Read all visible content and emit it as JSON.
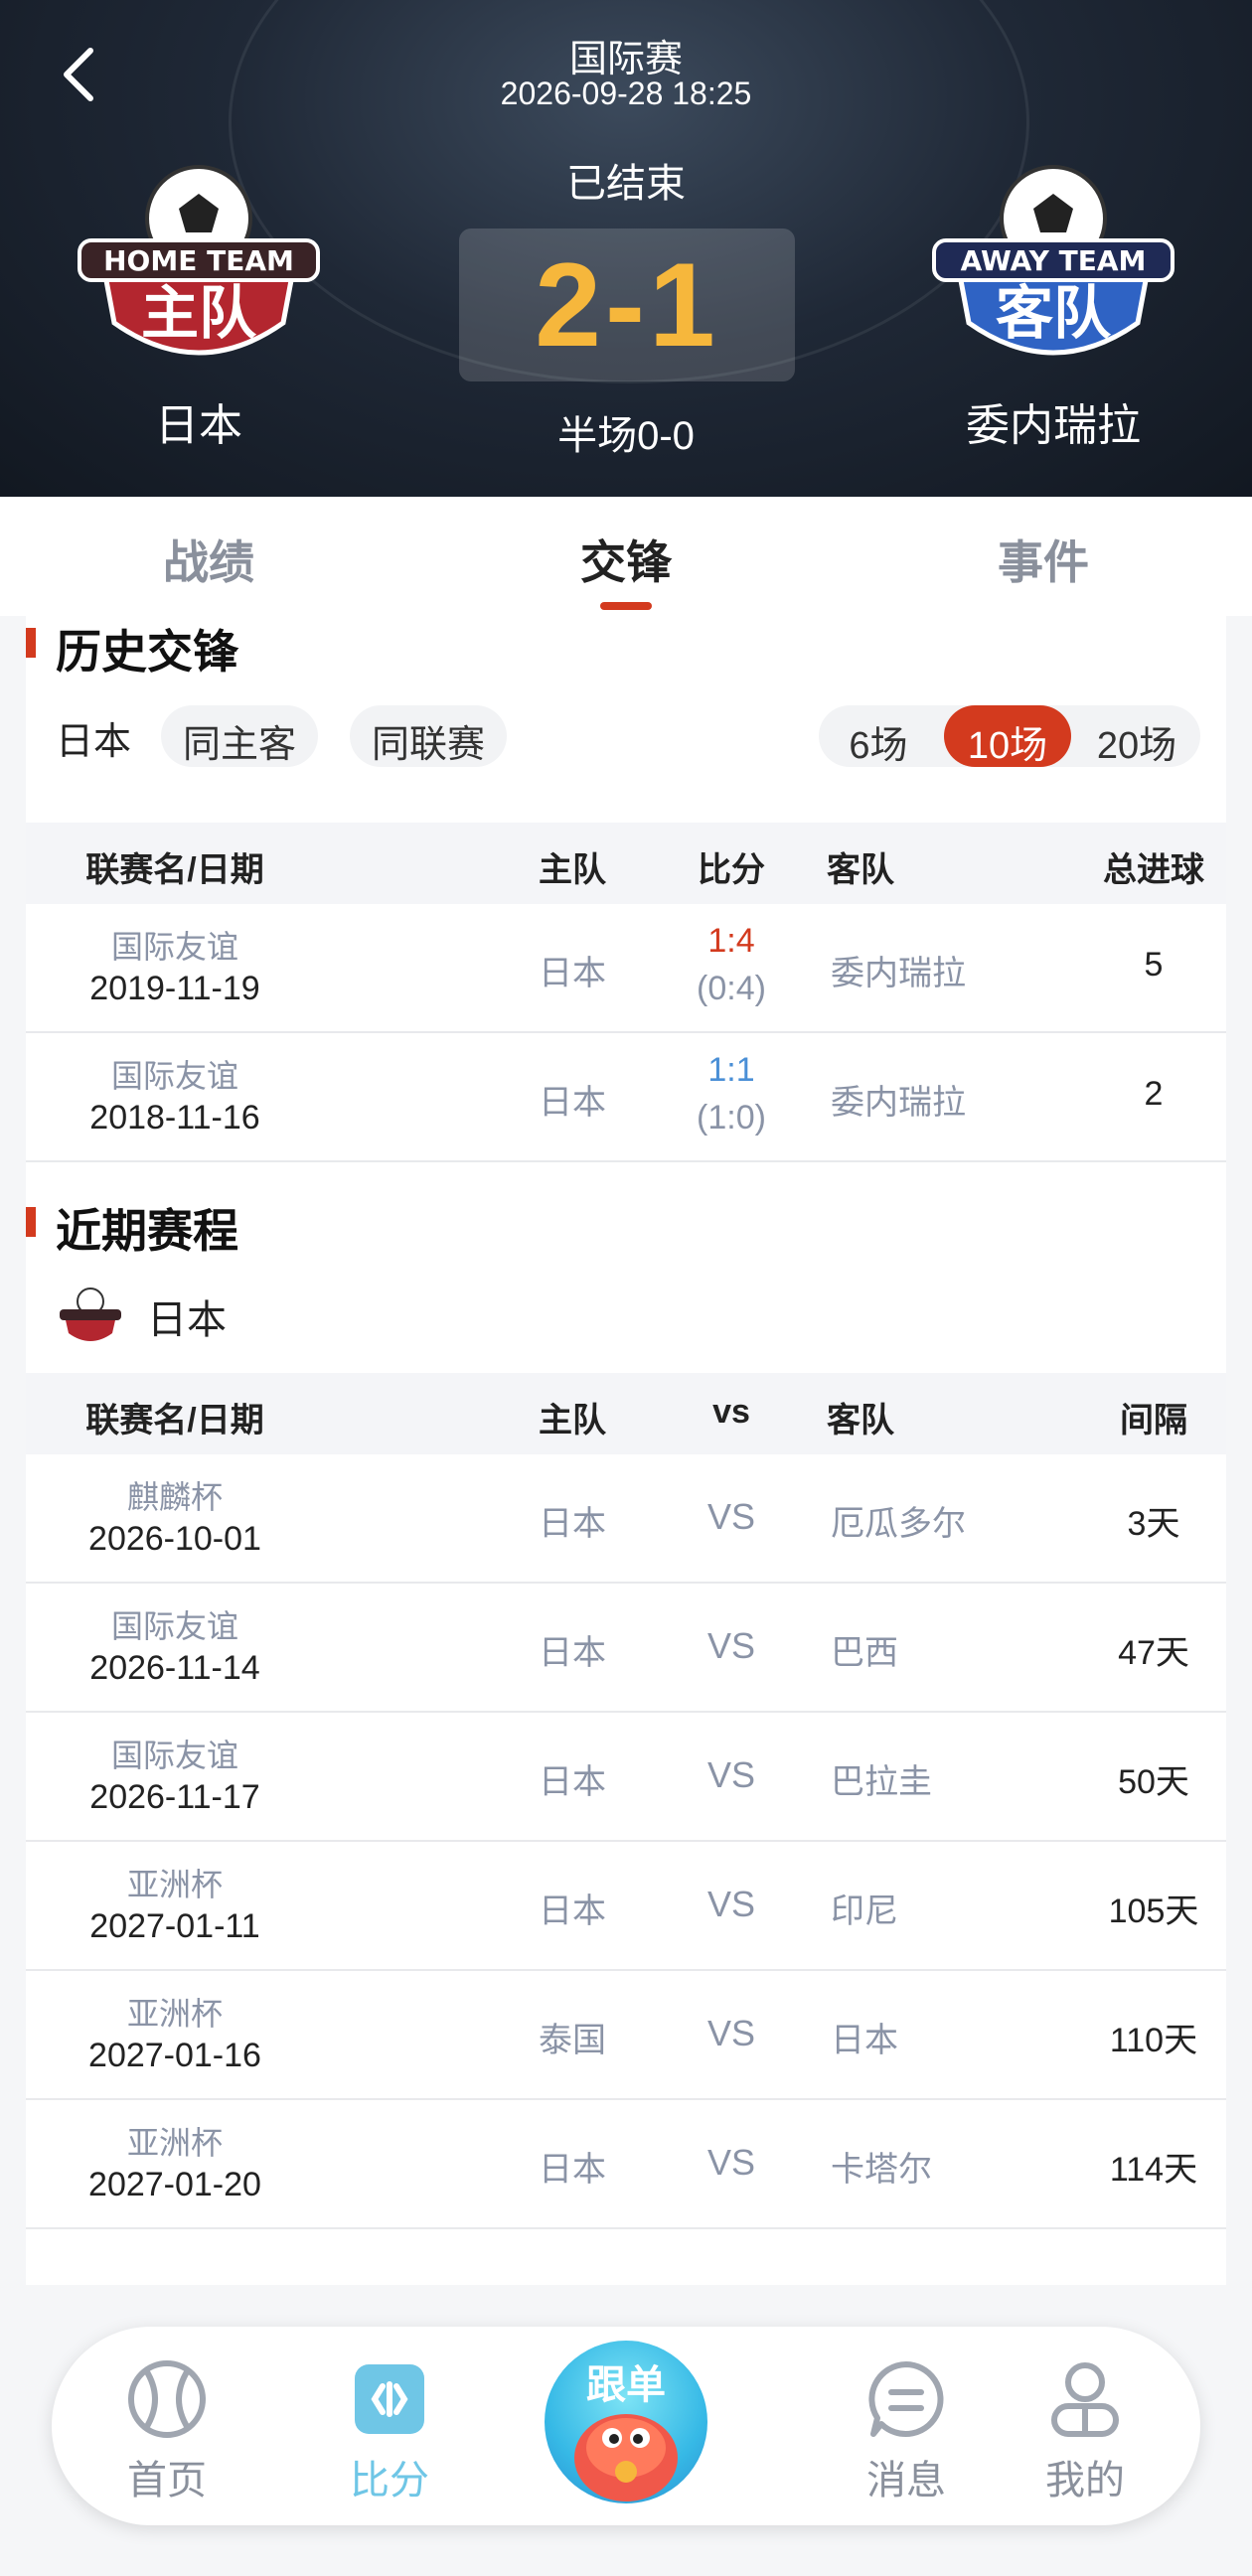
{
  "header": {
    "league": "国际赛",
    "time": "2026-09-28 18:25",
    "status": "已结束",
    "score": "2-1",
    "half_score": "半场0-0",
    "home_team": "日本",
    "away_team": "委内瑞拉",
    "home_logo_text": "HOME TEAM",
    "home_logo_cn": "主队",
    "away_logo_text": "AWAY TEAM",
    "away_logo_cn": "客队"
  },
  "tabs": [
    {
      "label": "战绩"
    },
    {
      "label": "交锋"
    },
    {
      "label": "事件"
    }
  ],
  "history": {
    "title": "历史交锋",
    "team": "日本",
    "chips": [
      "同主客",
      "同联赛"
    ],
    "counts": [
      "6场",
      "10场",
      "20场"
    ],
    "active_count": "10场",
    "headers": {
      "league_date": "联赛名/日期",
      "home": "主队",
      "score": "比分",
      "away": "客队",
      "total": "总进球"
    },
    "rows": [
      {
        "league": "国际友谊",
        "date": "2019-11-19",
        "home": "日本",
        "score": "1:4",
        "half": "(0:4)",
        "away": "委内瑞拉",
        "total": "5"
      },
      {
        "league": "国际友谊",
        "date": "2018-11-16",
        "home": "日本",
        "score": "1:1",
        "half": "(1:0)",
        "away": "委内瑞拉",
        "total": "2"
      }
    ]
  },
  "recent": {
    "title": "近期赛程",
    "team": "日本",
    "headers": {
      "league_date": "联赛名/日期",
      "home": "主队",
      "vs": "vs",
      "away": "客队",
      "gap": "间隔"
    },
    "rows": [
      {
        "league": "麒麟杯",
        "date": "2026-10-01",
        "home": "日本",
        "vs": "VS",
        "away": "厄瓜多尔",
        "gap": "3天"
      },
      {
        "league": "国际友谊",
        "date": "2026-11-14",
        "home": "日本",
        "vs": "VS",
        "away": "巴西",
        "gap": "47天"
      },
      {
        "league": "国际友谊",
        "date": "2026-11-17",
        "home": "日本",
        "vs": "VS",
        "away": "巴拉圭",
        "gap": "50天"
      },
      {
        "league": "亚洲杯",
        "date": "2027-01-11",
        "home": "日本",
        "vs": "VS",
        "away": "印尼",
        "gap": "105天"
      },
      {
        "league": "亚洲杯",
        "date": "2027-01-16",
        "home": "泰国",
        "vs": "VS",
        "away": "日本",
        "gap": "110天"
      },
      {
        "league": "亚洲杯",
        "date": "2027-01-20",
        "home": "日本",
        "vs": "VS",
        "away": "卡塔尔",
        "gap": "114天"
      }
    ]
  },
  "nav": {
    "items": [
      {
        "label": "首页",
        "icon": "tennis-ball-icon"
      },
      {
        "label": "比分",
        "icon": "score-icon"
      },
      {
        "label": "消息",
        "icon": "message-icon"
      },
      {
        "label": "我的",
        "icon": "profile-icon"
      }
    ],
    "center_label": "跟单",
    "active": "比分"
  },
  "colors": {
    "accent": "#d33a1e",
    "score_gold": "#f6b73c",
    "nav_active": "#6fc6e6",
    "win_red": "#d33a1e",
    "draw_blue": "#4a8fd6"
  }
}
